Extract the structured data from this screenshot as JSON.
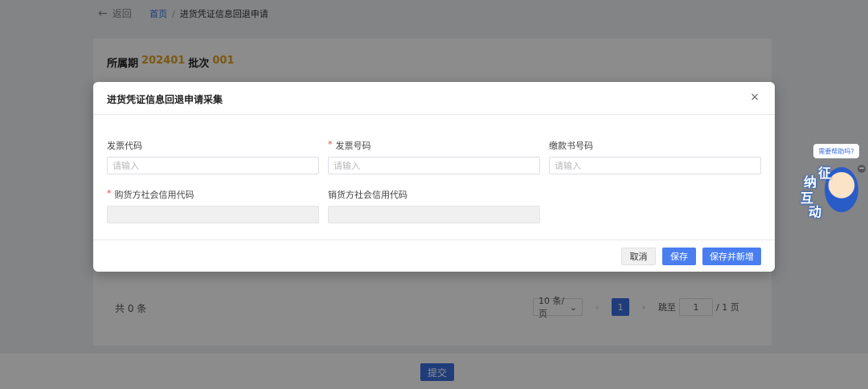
{
  "topbar": {
    "back_label": "返回",
    "breadcrumb_home": "首页",
    "breadcrumb_sep": "/",
    "breadcrumb_current": "进货凭证信息回退申请"
  },
  "period": {
    "label": "所属期",
    "value": "202401",
    "batch_label": "批次",
    "batch_value": "001"
  },
  "table": {
    "total": "共 0 条",
    "page_size": "10 条/页",
    "current_page": "1",
    "jump_label": "跳至",
    "jump_value": "1",
    "total_pages": "/ 1 页"
  },
  "footer": {
    "submit_label": "提交"
  },
  "modal": {
    "title": "进货凭证信息回退申请采集",
    "close": "×",
    "fields": {
      "invoice_code": {
        "label": "发票代码",
        "placeholder": "请输入",
        "required": false
      },
      "invoice_number": {
        "label": "发票号码",
        "placeholder": "请输入",
        "required": true,
        "required_mark": "*"
      },
      "payment_number": {
        "label": "缴款书号码",
        "placeholder": "请输入",
        "required": false
      },
      "buyer_credit_code": {
        "label": "购货方社会信用代码",
        "required": true,
        "required_mark": "*"
      },
      "seller_credit_code": {
        "label": "销货方社会信用代码",
        "required": false
      }
    },
    "buttons": {
      "cancel": "取消",
      "save": "保存",
      "save_and_new": "保存并新增"
    }
  },
  "widget": {
    "help_text": "需要帮助吗?",
    "char_zheng": "征",
    "char_na": "纳",
    "char_hu": "互",
    "char_dong": "动",
    "minimize": "−"
  },
  "colors": {
    "primary": "#4a7ef0",
    "period_value": "#e0a020",
    "required": "#e54545"
  }
}
